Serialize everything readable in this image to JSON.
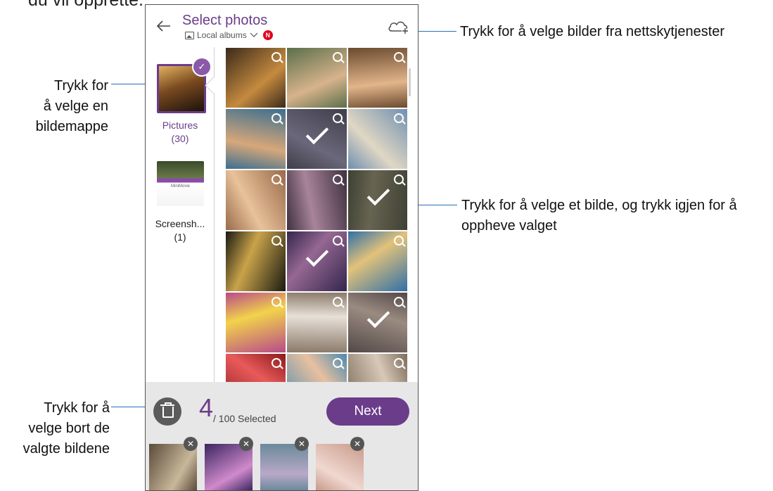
{
  "top_fragment": "du vil opprette.",
  "header": {
    "title": "Select photos",
    "subtitle": "Local albums",
    "badge": "N"
  },
  "albums": [
    {
      "name": "Pictures",
      "count": "(30)",
      "selected": true
    },
    {
      "name": "Screensh...",
      "count": "(1)",
      "selected": false
    },
    {
      "thumb_text": "MiniMovie"
    }
  ],
  "grid": {
    "selected_cells": [
      4,
      8,
      10,
      14
    ],
    "colors": [
      [
        "#3a2a1a",
        "#c58a3f"
      ],
      [
        "#5a6f4a",
        "#d7b38c"
      ],
      [
        "#6a4a2f",
        "#e2b58a"
      ],
      [
        "#3c6f8f",
        "#d7a77a"
      ],
      [
        "#4d4a5c",
        "#8f8aa8"
      ],
      [
        "#6f8fb0",
        "#e0d7c4"
      ],
      [
        "#9a6a4a",
        "#e8c29a"
      ],
      [
        "#3f3040",
        "#a8849a"
      ],
      [
        "#4a4f3a",
        "#8a8468"
      ],
      [
        "#1a1a12",
        "#c9a34a"
      ],
      [
        "#3a2560",
        "#d08acb"
      ],
      [
        "#2f6fa8",
        "#e2c27a"
      ],
      [
        "#b84a8a",
        "#f2d34a"
      ],
      [
        "#8a7a6a",
        "#e8e0d8"
      ],
      [
        "#6a5a5a",
        "#d8c0b0"
      ],
      [
        "#8a1a1a",
        "#e85a5a"
      ],
      [
        "#4a8ab0",
        "#e8c0a0"
      ],
      [
        "#7a6a5a",
        "#d8c8b8"
      ]
    ]
  },
  "bottom": {
    "count": "4",
    "count_suffix": "/ 100 Selected",
    "next_label": "Next",
    "chips": [
      [
        "#5a4a3a",
        "#c8b89a"
      ],
      [
        "#3a2560",
        "#d08acb"
      ],
      [
        "#6a8a9a",
        "#b8a8c8"
      ],
      [
        "#c89a8a",
        "#f0d8d0"
      ]
    ]
  },
  "annotations": {
    "cloud": "Trykk for å velge bilder fra nettskytjenester",
    "folder": [
      "Trykk for",
      "å velge en",
      "bildemappe"
    ],
    "photo": [
      "Trykk for å velge et bilde, og trykk igjen for å",
      "oppheve valget"
    ],
    "deselect": [
      "Trykk for å",
      "velge bort de",
      "valgte bildene"
    ]
  },
  "colors": {
    "accent": "#6b3c8a",
    "leader_line": "#2a6fb6"
  }
}
